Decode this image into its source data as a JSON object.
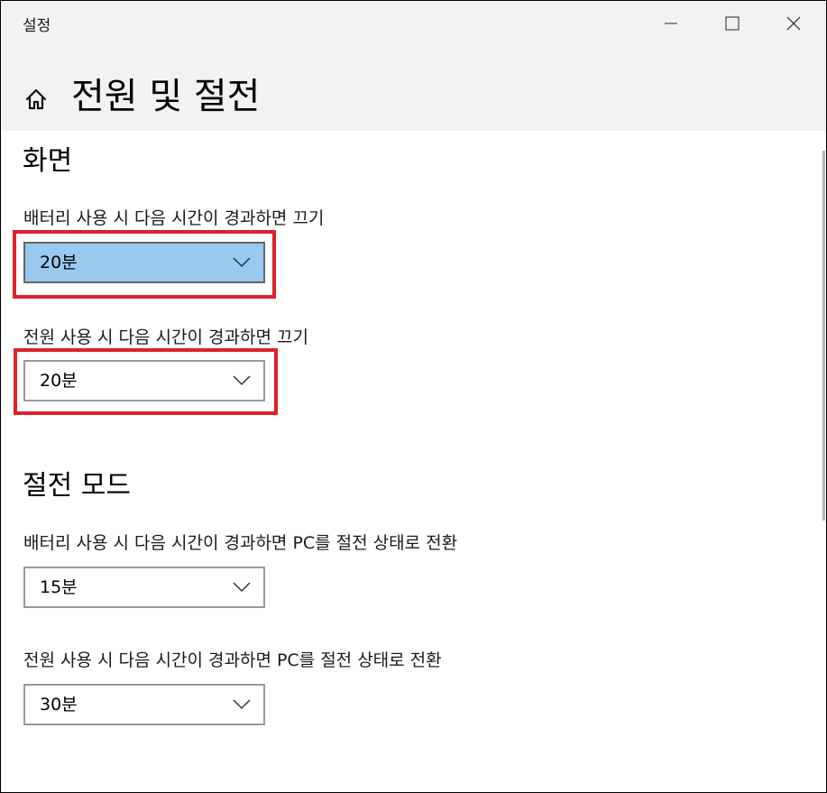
{
  "window": {
    "app_title": "설정",
    "controls": {
      "minimize_icon": "minimize-icon",
      "maximize_icon": "maximize-icon",
      "close_icon": "close-icon"
    }
  },
  "header": {
    "home_icon": "home-icon",
    "title": "전원 및 절전"
  },
  "sections": {
    "screen": {
      "heading": "화면",
      "battery_label": "배터리 사용 시 다음 시간이 경과하면 끄기",
      "battery_value": "20분",
      "plugged_label": "전원 사용 시 다음 시간이 경과하면 끄기",
      "plugged_value": "20분"
    },
    "sleep": {
      "heading": "절전 모드",
      "battery_label": "배터리 사용 시 다음 시간이 경과하면 PC를 절전 상태로 전환",
      "battery_value": "15분",
      "plugged_label": "전원 사용 시 다음 시간이 경과하면 PC를 절전 상태로 전환",
      "plugged_value": "30분"
    }
  },
  "colors": {
    "chrome_background": "#f2f2f2",
    "selected_dropdown": "#99c9ef",
    "annotation_highlight": "#e0202a",
    "dropdown_border": "#999999"
  }
}
